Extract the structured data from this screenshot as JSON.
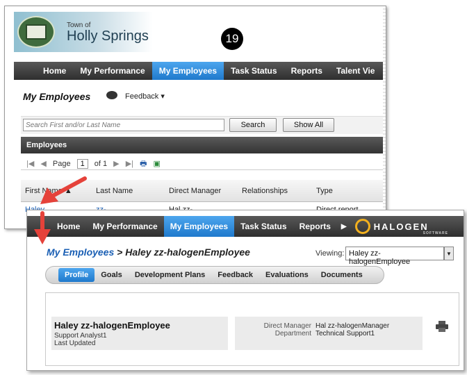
{
  "step_number": "19",
  "back": {
    "logo": {
      "small": "Town of",
      "big": "Holly Springs"
    },
    "nav": [
      "Home",
      "My Performance",
      "My Employees",
      "Task Status",
      "Reports",
      "Talent Vie"
    ],
    "page_title": "My Employees",
    "feedback_label": "Feedback ▾",
    "search": {
      "placeholder": "Search First and/or Last Name",
      "search_button": "Search",
      "show_all_button": "Show All"
    },
    "grid_title": "Employees",
    "pager": {
      "page_label": "Page",
      "page_value": "1",
      "of_label": "of 1"
    },
    "columns": [
      "First Name ▲",
      "Last Name",
      "Direct Manager",
      "Relationships",
      "Type"
    ],
    "row": {
      "first": "Haley",
      "last": "zz-",
      "manager": "Hal zz-",
      "relationships": "",
      "type": "Direct report"
    }
  },
  "front": {
    "nav": [
      "Home",
      "My Performance",
      "My Employees",
      "Task Status",
      "Reports"
    ],
    "brand": "HALOGEN",
    "brand_sub": "SOFTWARE",
    "breadcrumb_link": "My Employees",
    "breadcrumb_rest": " > Haley zz-halogenEmployee",
    "viewing_label": "Viewing:",
    "viewing_value": "Haley zz-halogenEmployee",
    "tabs": [
      "Profile",
      "Goals",
      "Development Plans",
      "Feedback",
      "Evaluations",
      "Documents"
    ],
    "profile": {
      "name": "Haley zz-halogenEmployee",
      "title": "Support Analyst1",
      "last_updated": "Last Updated",
      "direct_manager_label": "Direct Manager",
      "direct_manager_value": "Hal zz-halogenManager",
      "department_label": "Department",
      "department_value": "Technical Support1"
    }
  },
  "colors": {
    "active_tab": "#1f79cc",
    "arrow": "#e5423a",
    "link": "#1a5fb4"
  }
}
